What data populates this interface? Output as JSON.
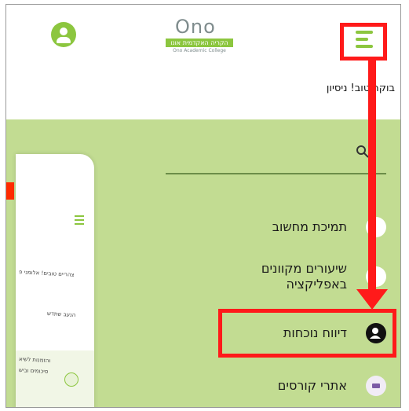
{
  "header": {
    "logo": {
      "wordmark": "Ono",
      "hebrew_line": "הקריה האקדמית אונו",
      "english_line": "Ono Academic College"
    },
    "greeting": "בוקר טוב! ניסיון"
  },
  "menu": {
    "items": [
      {
        "label": "תמיכת מחשוב",
        "icon": "support-icon"
      },
      {
        "label_line1": "שיעורים מקוונים",
        "label_line2": "באפליקציה",
        "icon": "online-lessons-icon"
      },
      {
        "label": "דיווח נוכחות",
        "icon": "attendance-icon"
      },
      {
        "label": "אתרי קורסים",
        "icon": "courses-icon"
      }
    ]
  },
  "phone_preview": {
    "greeting": "צהריים טובים! אלומני פ",
    "subtitle": "הנעב שתדש",
    "card_line1": "והזמנות לשיא",
    "card_line2": "סיכומים וביש"
  },
  "colors": {
    "brand_green": "#8cc63f",
    "content_bg": "#c2dc92",
    "highlight_red": "#ff1a1a"
  }
}
